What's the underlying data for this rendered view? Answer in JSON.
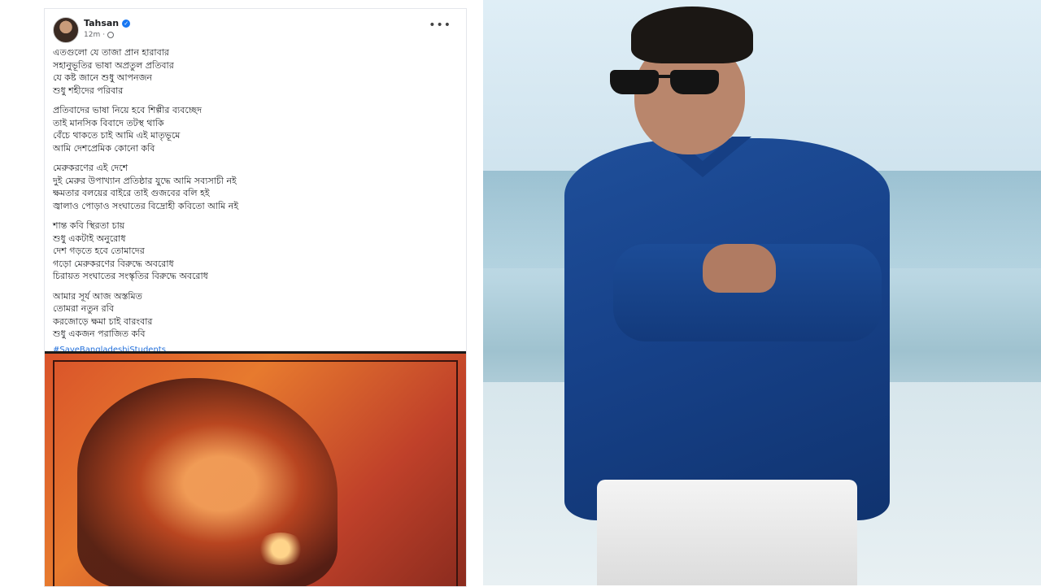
{
  "post": {
    "author": "Tahsan",
    "time": "12m",
    "privacy_icon": "globe-icon",
    "verified_icon": "verified-badge-icon",
    "more_label": "•••",
    "stanzas": [
      [
        "এতগুলো যে তাজা প্রান হারাবার",
        "সহানুভূতির ভাষা অপ্রতুল প্রতিবার",
        "যে কষ্ট জানে শুধু আপনজন",
        "শুধু শহীদের পরিবার"
      ],
      [
        "প্রতিবাদের ভাষা নিয়ে হবে শিল্পীর ব্যবচ্ছেদ",
        "তাই মানসিক বিবাদে তটস্থ থাকি",
        "বেঁচে থাকতে চাই আমি এই মাতৃভূমে",
        "আমি দেশপ্রেমিক কোনো কবি"
      ],
      [
        "মেরুকরণের এই দেশে",
        "দুই মেরুর উপাখ্যান প্রতিষ্ঠার যুদ্ধে আমি সব্যসাচী নই",
        "ক্ষমতার বলয়ের বাইরে তাই গুজবের বলি হই",
        "জ্বালাও পোড়াও সংঘাতের বিদ্রোহী কবিতো আমি নই"
      ],
      [
        "শান্ত কবি স্থিরতা চায়",
        "শুধু একটাই অনুরোধ",
        "দেশ গড়তে হবে তোমাদের",
        "গড়ো মেরুকরণের বিরুদ্ধে অবরোধ",
        "চিরায়ত সংঘাতের সংস্কৃতির বিরুদ্ধে অবরোধ"
      ],
      [
        "আমার সূর্য আজ অস্তমিত",
        "তোমরা নতুন রবি",
        "করজোড়ে ক্ষমা চাই বারংবার",
        "শুধু একজন পরাজিত কবি"
      ]
    ],
    "hashtag": "#SaveBangladeshiStudents"
  },
  "colors": {
    "link": "#216fdb",
    "verified": "#1877f2",
    "shirt": "#1f4f9a"
  }
}
